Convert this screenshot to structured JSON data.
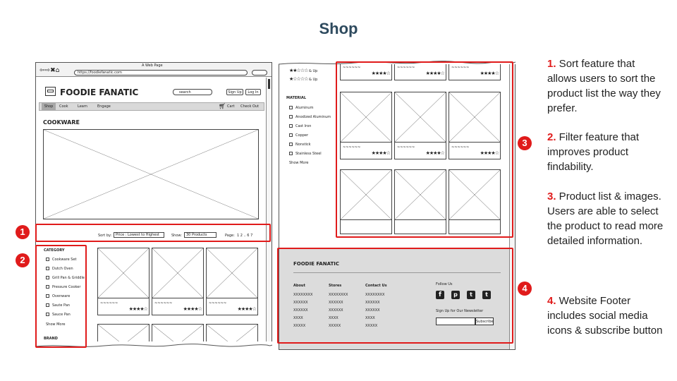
{
  "title": "Shop",
  "left": {
    "window_title": "A Web Page",
    "url": "https://foodiefanatic.com",
    "brand": "FOODIE FANATIC",
    "search_placeholder": "search",
    "signup": "Sign Up",
    "login": "Log In",
    "nav": [
      "Shop",
      "Cook",
      "Learn",
      "Engage"
    ],
    "cart": "Cart",
    "checkout": "Check Out",
    "page_heading": "COOKWARE",
    "sort_label": "Sort by:",
    "sort_value": "Price : Lowest to Highest",
    "show_label": "Show:",
    "show_value": "30 Products",
    "page_label": "Page:",
    "page_numbers": "1 2 .. 6 7",
    "category_heading": "CATEGORY",
    "categories": [
      "Cookware Set",
      "Dutch Oven",
      "Grill Pan & Griddle",
      "Pressure Cooker",
      "Ovenware",
      "Saute Pan",
      "Sauce Pan"
    ],
    "show_more": "Show More",
    "brand_heading": "BRAND",
    "product_name": "~~~~~~",
    "product_stars": "★★★★☆"
  },
  "right": {
    "rating_rows": [
      {
        "stars": "★★☆☆☆",
        "label": "& Up"
      },
      {
        "stars": "★☆☆☆☆",
        "label": "& Up"
      }
    ],
    "material_heading": "MATERIAL",
    "materials": [
      "Aluminum",
      "Anodized Aluminum",
      "Cast Iron",
      "Copper",
      "Nonstick",
      "Stainless Steel"
    ],
    "show_more": "Show More",
    "footer": {
      "brand": "FOODIE FANATIC",
      "columns": [
        {
          "heading": "About",
          "items": [
            "XXXXXXXX",
            "XXXXXX",
            "XXXXXX",
            "XXXX",
            "XXXXX"
          ]
        },
        {
          "heading": "Stores",
          "items": [
            "XXXXXXXX",
            "XXXXXX",
            "XXXXXX",
            "XXXX",
            "XXXXX"
          ]
        },
        {
          "heading": "Contact Us",
          "items": [
            "XXXXXXXX",
            "XXXXXX",
            "XXXXXX",
            "XXXX",
            "XXXXX"
          ]
        }
      ],
      "follow_us": "Follow Us",
      "newsletter": "Sign Up for Our Newsletter",
      "subscribe": "Subscribe"
    }
  },
  "badges": [
    "1",
    "2",
    "3",
    "4"
  ],
  "captions": [
    {
      "num": "1.",
      "text": " Sort feature that allows users to sort the product list the way they prefer."
    },
    {
      "num": "2.",
      "text": " Filter feature that improves product findability."
    },
    {
      "num": "3.",
      "text": " Product list & images.  Users are able to select the product to read more detailed information."
    },
    {
      "num": "4.",
      "text": " Website Footer includes social media icons & subscribe button"
    }
  ],
  "colors": {
    "accent": "#e01b1b",
    "title": "#2e4a5e",
    "footer_bg": "#dcdcdc",
    "nav_bg": "#d9d9d9"
  }
}
